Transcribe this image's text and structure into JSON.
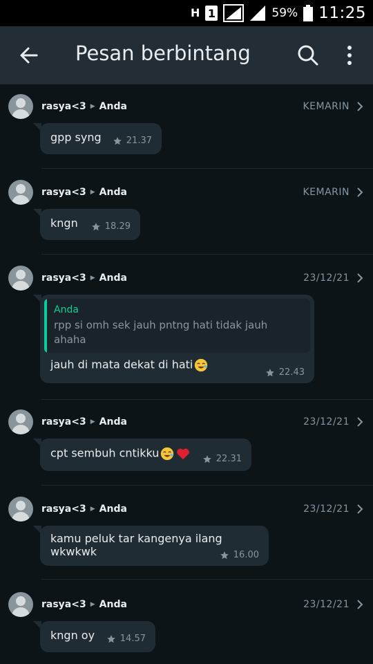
{
  "status_bar": {
    "network_h": "H",
    "sim": "1",
    "battery": "59%",
    "time": "11:25"
  },
  "app_bar": {
    "title": "Pesan berbintang",
    "icons": [
      "arrow-back-icon",
      "search-icon",
      "more-vert-icon"
    ]
  },
  "messages": [
    {
      "sender": "rasya<3",
      "receiver": "Anda",
      "date": "KEMARIN",
      "text": "gpp syng",
      "time": "21.37"
    },
    {
      "sender": "rasya<3",
      "receiver": "Anda",
      "date": "KEMARIN",
      "text": "kngn",
      "time": "18.29"
    },
    {
      "sender": "rasya<3",
      "receiver": "Anda",
      "date": "23/12/21",
      "quote_name": "Anda",
      "quote_text": "rpp si omh sek jauh pntng hati tidak jauh ahaha",
      "text": "jauh di mata dekat di hati",
      "emojis": [
        "rolling-laughing-emoji"
      ],
      "time": "22.43"
    },
    {
      "sender": "rasya<3",
      "receiver": "Anda",
      "date": "23/12/21",
      "text": "cpt sembuh cntikku",
      "emojis": [
        "rolling-laughing-emoji",
        "red-heart-emoji"
      ],
      "time": "22.31"
    },
    {
      "sender": "rasya<3",
      "receiver": "Anda",
      "date": "23/12/21",
      "text": "kamu peluk tar kangenya ilang wkwkwk",
      "time": "16.00"
    },
    {
      "sender": "rasya<3",
      "receiver": "Anda",
      "date": "23/12/21",
      "text": "kngn oy",
      "time": "14.57"
    }
  ],
  "colors": {
    "background": "#0d1418",
    "app_bar": "#232d36",
    "bubble": "#202c33",
    "accent_green": "#06cf9c",
    "meta_gray": "#8696a0"
  }
}
